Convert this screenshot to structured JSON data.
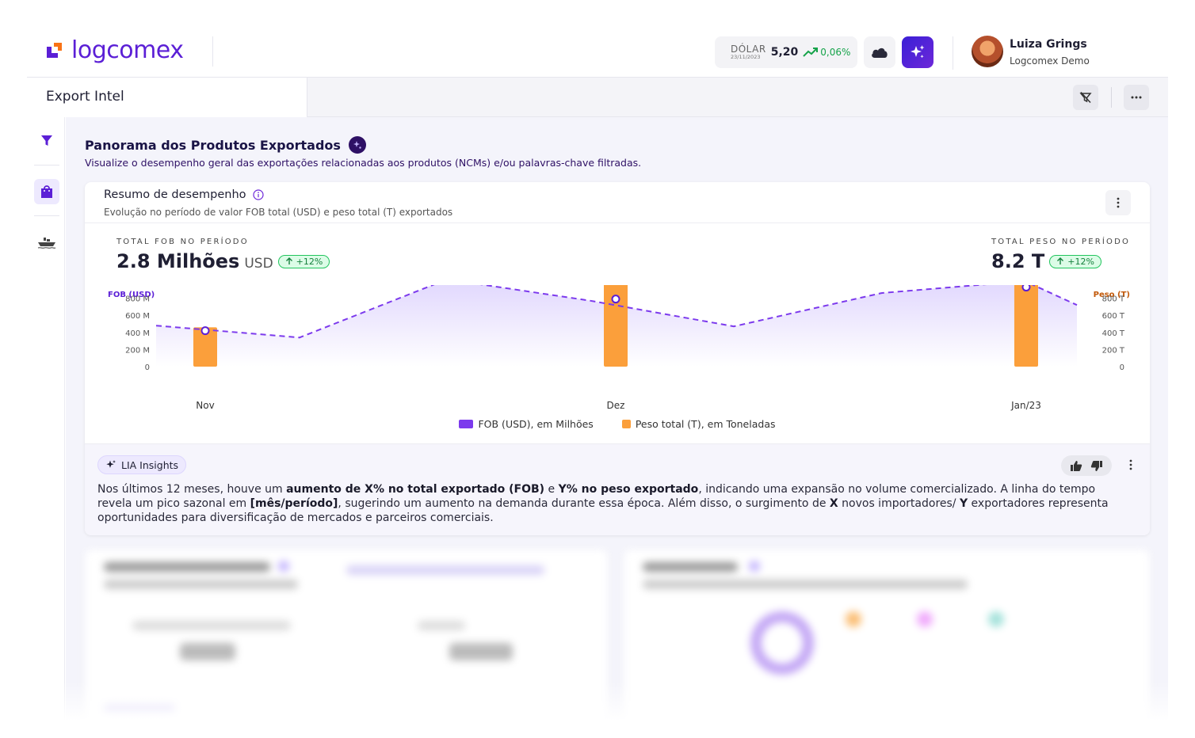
{
  "header": {
    "logo_text": "logcomex",
    "dollar": {
      "label": "DÓLAR",
      "date": "23/11/2023",
      "value": "5,20",
      "variation": "0,06%"
    },
    "user": {
      "name": "Luiza Grings",
      "org": "Logcomex Demo"
    }
  },
  "subheader": {
    "title": "Export Intel"
  },
  "rail": {
    "icons": [
      "filter-icon",
      "shopping-bag-icon",
      "ship-icon"
    ]
  },
  "page": {
    "title": "Panorama dos Produtos Exportados",
    "subtitle": "Visualize o desempenho geral das exportações relacionadas aos produtos (NCMs) e/ou palavras-chave filtradas."
  },
  "summary_card": {
    "title": "Resumo de desempenho",
    "subtitle": "Evolução no período de valor FOB total (USD) e peso total (T) exportados",
    "kpi_fob": {
      "label": "TOTAL FOB NO PERÍODO",
      "value": "2.8 Milhões",
      "unit": "USD",
      "badge": "+12%"
    },
    "kpi_weight": {
      "label": "TOTAL PESO NO PERÍODO",
      "value": "8.2 T",
      "badge": "+12%"
    }
  },
  "chart_data": {
    "type": "bar",
    "categories": [
      "Nov",
      "Dez",
      "Jan/23"
    ],
    "left_axis": {
      "label": "FOB (USD)",
      "ticks": [
        "800 M",
        "600 M",
        "400 M",
        "200 M",
        "0"
      ],
      "ylim": [
        0,
        1000
      ]
    },
    "right_axis": {
      "label": "Peso (T)",
      "ticks": [
        "800 T",
        "600 T",
        "400 T",
        "200 T",
        "0"
      ],
      "ylim": [
        0,
        1000
      ]
    },
    "series": [
      {
        "name": "FOB (USD), em Milhões",
        "kind": "line",
        "color": "#7c3aed",
        "points": [
          [
            0,
            480
          ],
          [
            0.33,
            340
          ],
          [
            0.67,
            1020
          ],
          [
            1,
            770
          ],
          [
            1.33,
            470
          ],
          [
            1.67,
            860
          ],
          [
            2,
            1000
          ],
          [
            2.12,
            720
          ]
        ],
        "markers": [
          [
            0,
            420
          ],
          [
            1,
            790
          ],
          [
            2,
            930
          ]
        ]
      },
      {
        "name": "Peso total (T), em Toneladas",
        "kind": "bar",
        "color": "#fb9f3b",
        "values": [
          460,
          1020,
          1020
        ]
      }
    ],
    "legend": [
      {
        "label": "FOB (USD), em Milhões",
        "color": "#7c3aed"
      },
      {
        "label": "Peso total (T), em Toneladas",
        "color": "#fb9f3b"
      }
    ]
  },
  "insights": {
    "chip": "LIA Insights",
    "p1": "Nos últimos 12 meses, houve um ",
    "b1": "aumento de X% no total exportado (FOB)",
    "p2": " e ",
    "b2": "Y% no peso exportado",
    "p3": ", indicando uma expansão no volume comercializado. A linha do tempo revela um pico sazonal em ",
    "b3": "[mês/período]",
    "p4": ", sugerindo um aumento na demanda durante essa época. Além disso, o surgimento de ",
    "b4": "X",
    "p5": " novos importadores/ ",
    "b5": "Y",
    "p6": " exportadores representa oportunidades para diversificação de mercados e parceiros comerciais."
  },
  "colors": {
    "brand": "#5b1fd6",
    "fob": "#7c3aed",
    "weight": "#fb9f3b",
    "positive": "#16a34a"
  }
}
